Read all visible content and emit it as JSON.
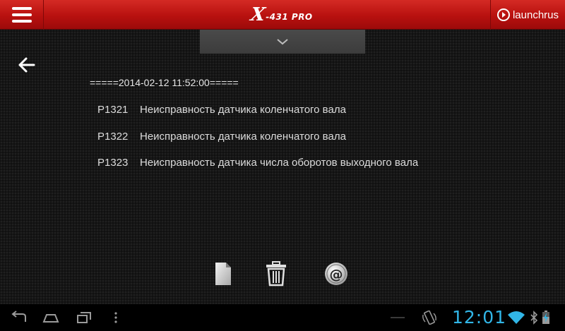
{
  "header": {
    "logo_x": "X",
    "logo_rest": "-431 PRO",
    "brand_label": "launchrus"
  },
  "report": {
    "date_line": "=====2014-02-12 11:52:00=====",
    "codes": [
      {
        "code": "P1321",
        "description": "Неисправность датчика коленчатого вала"
      },
      {
        "code": "P1322",
        "description": "Неисправность датчика коленчатого вала"
      },
      {
        "code": "P1323",
        "description": "Неисправность датчика числа оборотов выходного вала"
      }
    ]
  },
  "actions": {
    "mail_symbol": "@"
  },
  "system_bar": {
    "clock": "12:01"
  },
  "colors": {
    "header_red": "#c11a16",
    "clock_blue": "#31b6e7",
    "background": "#161616"
  },
  "icons": [
    "menu-icon",
    "launch-logo-icon",
    "chevron-down-icon",
    "back-arrow-icon",
    "file-icon",
    "trash-icon",
    "email-icon",
    "nav-back-icon",
    "home-icon",
    "recent-apps-icon",
    "overflow-menu-icon",
    "screen-rotation-icon",
    "wifi-icon",
    "bluetooth-icon",
    "battery-icon"
  ]
}
